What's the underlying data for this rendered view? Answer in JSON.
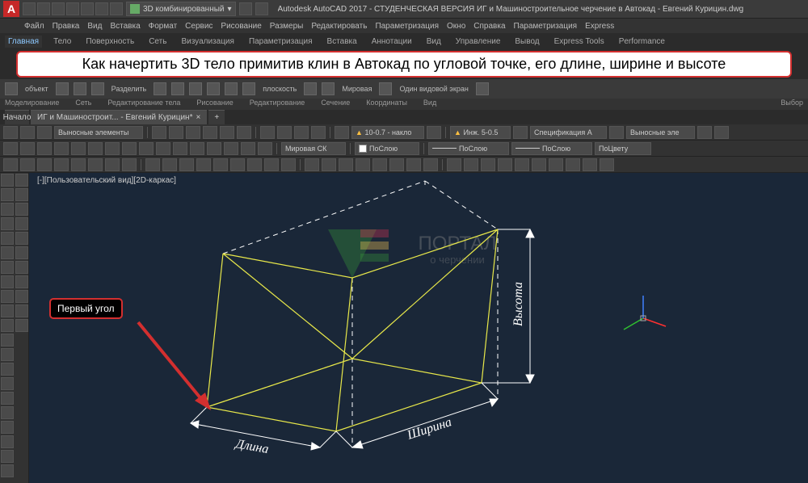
{
  "title_bar": {
    "app_initial": "A",
    "view_mode": "3D комбинированный",
    "app_title": "Autodesk AutoCAD 2017 - СТУДЕНЧЕСКАЯ ВЕРСИЯ   ИГ и Машиностроительное черчение в Автокад - Евгений Курицин.dwg"
  },
  "menu": {
    "items": [
      "Файл",
      "Правка",
      "Вид",
      "Вставка",
      "Формат",
      "Сервис",
      "Рисование",
      "Размеры",
      "Редактировать",
      "Параметризация",
      "Окно",
      "Справка",
      "Параметризация",
      "Express"
    ]
  },
  "ribbon_tabs": {
    "items": [
      "Главная",
      "Тело",
      "Поверхность",
      "Сеть",
      "Визуализация",
      "Параметризация",
      "Вставка",
      "Аннотации",
      "Вид",
      "Управление",
      "Вывод",
      "Express Tools",
      "Performance"
    ],
    "active": 0
  },
  "banner": {
    "text": "Как начертить 3D тело примитив клин в Автокад по угловой точке, его длине, ширине и высоте"
  },
  "ribbon_panels": {
    "labels": [
      "Моделирование",
      "Сеть",
      "Редактирование тела",
      "Рисование",
      "Редактирование",
      "Сечение",
      "Координаты",
      "Вид",
      "Выбор"
    ],
    "items": [
      "объект",
      "Разделить",
      "плоскость",
      "Мировая",
      "Один видовой экран"
    ]
  },
  "doc_tabs": {
    "items": [
      "Начало",
      "ИГ и Машиностроит... - Евгений Курицин*"
    ],
    "active": 1,
    "plus": "+"
  },
  "toolbar1": {
    "combo1": "Выносные элементы",
    "combo2": "10-0.7 - накло",
    "combo3": "Инж. 5-0.5",
    "combo4": "Спецификация А",
    "combo5": "Выносные эле"
  },
  "toolbar2": {
    "combo1": "Мировая СК",
    "combo2": "ПоСлою",
    "combo3": "ПоСлою",
    "combo4": "ПоСлою",
    "combo5": "ПоЦвету"
  },
  "viewport": {
    "label": "[-][Пользовательский вид][2D-каркас]",
    "annotation": "Первый угол",
    "dims": {
      "length": "Длина",
      "width": "Ширина",
      "height": "Высота"
    },
    "watermark": "ПОРТАЛ",
    "watermark_sub": "о черчении"
  },
  "colors": {
    "accent_red": "#d32f2f",
    "wire_yellow": "#e8e84a",
    "axis_red": "#ff3030",
    "axis_green": "#30c030",
    "axis_blue": "#4080ff"
  }
}
